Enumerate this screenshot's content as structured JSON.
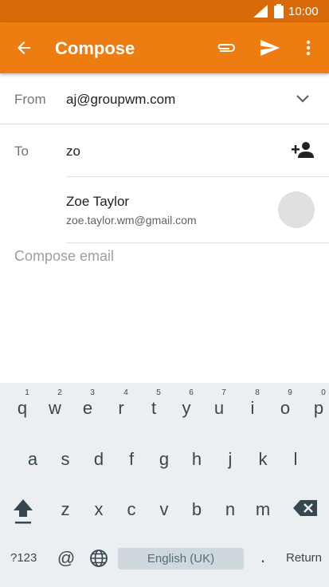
{
  "status": {
    "time": "10:00"
  },
  "appbar": {
    "title": "Compose"
  },
  "from": {
    "label": "From",
    "value": "aj@groupwm.com"
  },
  "to": {
    "label": "To",
    "value": "zo"
  },
  "suggestion": {
    "name": "Zoe Taylor",
    "email": "zoe.taylor.wm@gmail.com"
  },
  "compose": {
    "placeholder": "Compose email"
  },
  "keyboard": {
    "row1": [
      "q",
      "w",
      "e",
      "r",
      "t",
      "y",
      "u",
      "i",
      "o",
      "p"
    ],
    "row1_hints": [
      "1",
      "2",
      "3",
      "4",
      "5",
      "6",
      "7",
      "8",
      "9",
      "0"
    ],
    "row2": [
      "a",
      "s",
      "d",
      "f",
      "g",
      "h",
      "j",
      "k",
      "l"
    ],
    "row3": [
      "z",
      "x",
      "c",
      "v",
      "b",
      "n",
      "m"
    ],
    "symbols_label": "?123",
    "at_label": "@",
    "space_label": "English (UK)",
    "period_label": ".",
    "return_label": "Return"
  },
  "colors": {
    "appbar": "#ee7d11",
    "statusbar": "#d86a09",
    "keyboard_bg": "#eceff1"
  }
}
